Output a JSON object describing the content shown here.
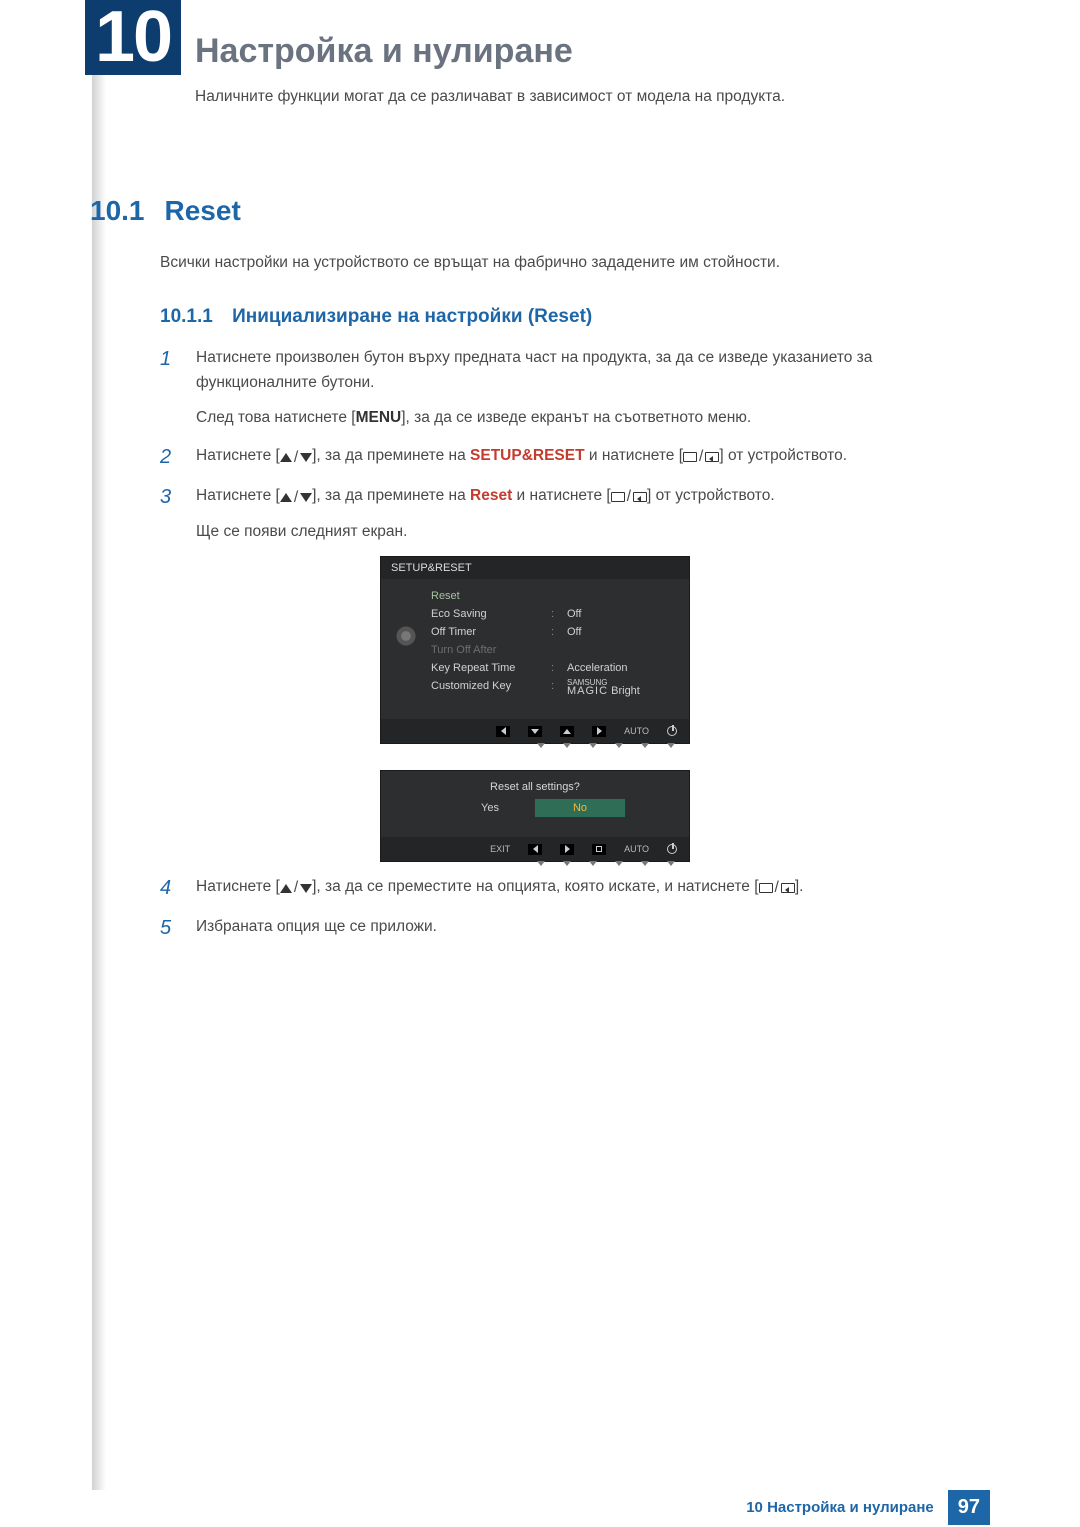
{
  "chapter": {
    "number": "10",
    "title": "Настройка и нулиране",
    "note": "Наличните функции могат да се различават в зависимост от модела на продукта."
  },
  "section": {
    "number": "10.1",
    "title": "Reset",
    "desc": "Всички настройки на устройството се връщат на фабрично зададените им стойности."
  },
  "subsection": {
    "number": "10.1.1",
    "title": "Инициализиране на настройки (Reset)"
  },
  "labels": {
    "menu": "MENU",
    "setup_reset": "SETUP&RESET",
    "reset": "Reset"
  },
  "steps": {
    "s1a": "Натиснете произволен бутон върху предната част на продукта, за да се изведе указанието за функционалните бутони.",
    "s1b_a": "След това натиснете [",
    "s1b_b": "], за да се изведе екранът на съответното меню.",
    "s2a": "Натиснете [",
    "s2b": "], за да преминете на ",
    "s2c": " и натиснете [",
    "s2d": "] от устройството.",
    "s3a": "Натиснете [",
    "s3b": "], за да преминете на ",
    "s3c": " и натиснете [",
    "s3d": "] от устройството.",
    "s3e": "Ще се появи следният екран.",
    "s4a": "Натиснете [",
    "s4b": "], за да се преместите на опцията, която искате, и натиснете [",
    "s4c": "].",
    "s5": "Избраната опция ще се приложи."
  },
  "osd1": {
    "title": "SETUP&RESET",
    "rows": [
      {
        "label": "Reset",
        "value": ""
      },
      {
        "label": "Eco Saving",
        "value": "Off"
      },
      {
        "label": "Off Timer",
        "value": "Off"
      },
      {
        "label": "Turn Off After",
        "value": ""
      },
      {
        "label": "Key Repeat Time",
        "value": "Acceleration"
      },
      {
        "label": "Customized Key",
        "value": "MAGIC Bright"
      }
    ],
    "nav_auto": "AUTO"
  },
  "osd2": {
    "question": "Reset all settings?",
    "yes": "Yes",
    "no": "No",
    "exit": "EXIT",
    "auto": "AUTO"
  },
  "footer": {
    "text": "10 Настройка и нулиране",
    "page": "97"
  }
}
